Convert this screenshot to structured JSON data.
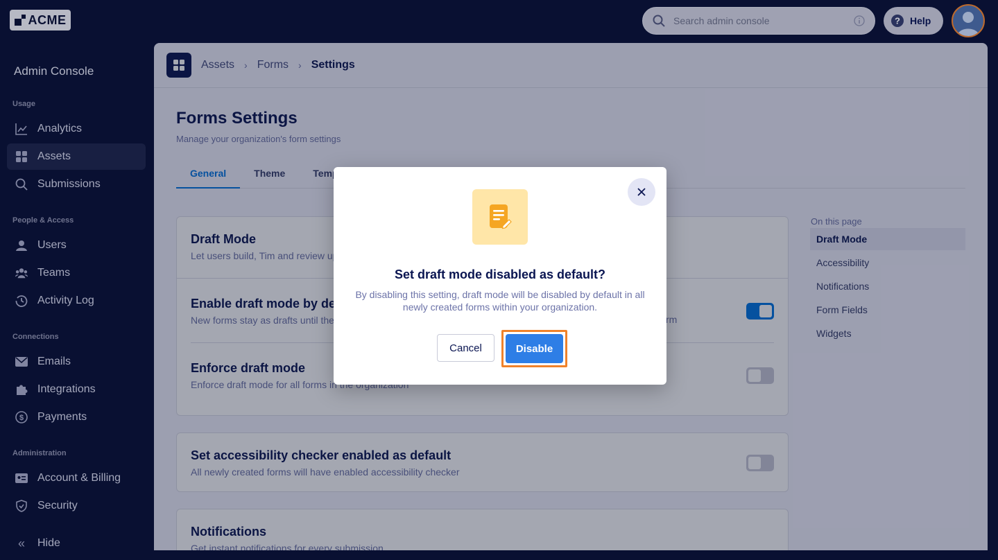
{
  "topbar": {
    "logo_text": "ACME",
    "search_placeholder": "Search admin console",
    "help_label": "Help"
  },
  "sidebar": {
    "title": "Admin Console",
    "sections": {
      "usage": "Usage",
      "people": "People & Access",
      "connections": "Connections",
      "administration": "Administration"
    },
    "items": [
      {
        "label": "Analytics",
        "icon": "chart-icon"
      },
      {
        "label": "Assets",
        "icon": "grid-icon",
        "active": true
      },
      {
        "label": "Submissions",
        "icon": "search-icon"
      },
      {
        "label": "Users",
        "icon": "user-icon"
      },
      {
        "label": "Teams",
        "icon": "team-icon"
      },
      {
        "label": "Activity Log",
        "icon": "history-icon"
      },
      {
        "label": "Emails",
        "icon": "mail-icon"
      },
      {
        "label": "Integrations",
        "icon": "puzzle-icon"
      },
      {
        "label": "Payments",
        "icon": "dollar-icon"
      },
      {
        "label": "Account & Billing",
        "icon": "id-card-icon"
      },
      {
        "label": "Security",
        "icon": "shield-icon"
      }
    ],
    "hide_label": "Hide"
  },
  "breadcrumb": {
    "items": [
      "Assets",
      "Forms",
      "Settings"
    ]
  },
  "page": {
    "title": "Forms Settings",
    "subtitle": "Manage your organization's form settings",
    "tabs": [
      "General",
      "Theme",
      "Temp"
    ]
  },
  "cards": {
    "draft_mode": {
      "title": "Draft Mode",
      "description": "Let users build, Tim and review up",
      "enable_title": "Enable draft mode by def",
      "enable_desc": "New forms stay as drafts until the",
      "enable_desc_tail": "rm",
      "enforce_title": "Enforce draft mode",
      "enforce_desc": "Enforce draft mode for all forms in the organization"
    },
    "accessibility": {
      "title": "Set accessibility checker enabled as default",
      "description": "All newly created forms will have enabled accessibility checker"
    },
    "notifications": {
      "title": "Notifications",
      "description": "Get instant notifications for every submission"
    }
  },
  "toc": {
    "heading": "On this page",
    "items": [
      "Draft Mode",
      "Accessibility",
      "Notifications",
      "Form Fields",
      "Widgets"
    ]
  },
  "modal": {
    "title": "Set draft mode disabled as default?",
    "text": "By disabling this setting, draft mode will be disabled by default in all newly created forms within your organization.",
    "cancel_label": "Cancel",
    "confirm_label": "Disable"
  },
  "colors": {
    "accent": "#0075e3",
    "highlight": "#f0822a",
    "sidebar_bg": "#0a1033"
  }
}
